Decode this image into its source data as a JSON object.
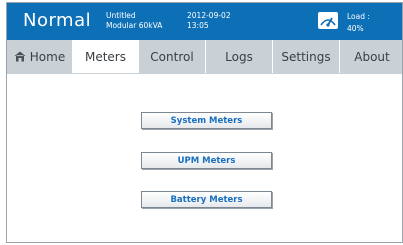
{
  "header": {
    "status": "Normal",
    "model_line1": "Untitled",
    "model_line2": "Modular 60kVA",
    "date": "2012-09-02",
    "time": "13:05",
    "load_icon": "load-gauge-icon",
    "load_label": "Load :",
    "load_value": "40%"
  },
  "tabs": [
    {
      "label": "Home",
      "icon": "home-icon"
    },
    {
      "label": "Meters"
    },
    {
      "label": "Control"
    },
    {
      "label": "Logs"
    },
    {
      "label": "Settings"
    },
    {
      "label": "About"
    }
  ],
  "active_tab": "Meters",
  "meters": {
    "system_label": "System Meters",
    "upm_label": "UPM Meters",
    "battery_label": "Battery Meters"
  },
  "colors": {
    "header_bg": "#0d6fb6",
    "tab_bg": "#c9d0d6",
    "button_text": "#1a6fbf"
  }
}
